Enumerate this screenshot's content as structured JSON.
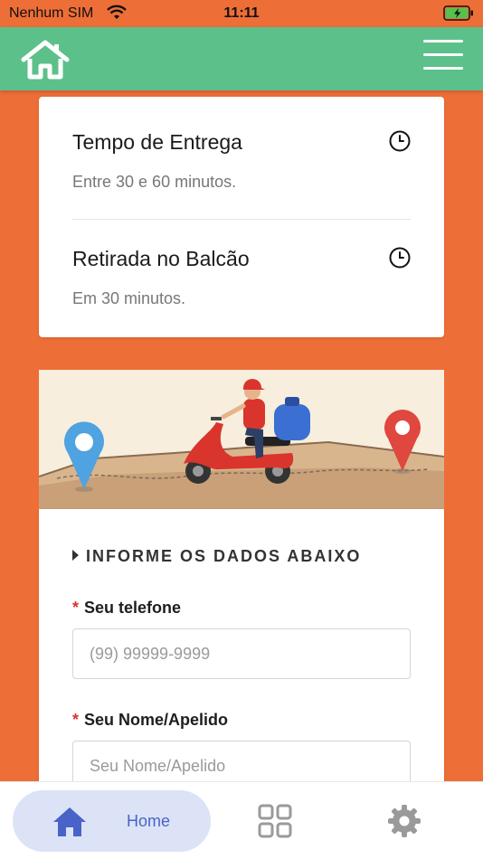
{
  "status_bar": {
    "carrier": "Nenhum SIM",
    "time": "11:11"
  },
  "header": {
    "home_icon": "home-icon",
    "menu_icon": "hamburger-menu-icon",
    "color": "#5CC08A"
  },
  "times_card": {
    "delivery": {
      "title": "Tempo de Entrega",
      "subtitle": "Entre 30 e 60 minutos."
    },
    "pickup": {
      "title": "Retirada no Balcão",
      "subtitle": "Em 30 minutos."
    },
    "icon": "clock-icon"
  },
  "form": {
    "heading": "INFORME OS DADOS ABAIXO",
    "phone": {
      "label": "Seu telefone",
      "placeholder": "(99) 99999-9999",
      "value": ""
    },
    "name": {
      "label": "Seu Nome/Apelido",
      "placeholder": "Seu Nome/Apelido",
      "value": ""
    },
    "required_mark": "*"
  },
  "bottom_nav": {
    "home_label": "Home",
    "active_color": "#4A63C9",
    "active_bg": "#DCE3F7"
  },
  "colors": {
    "background": "#EE6E37",
    "header": "#5CC08A",
    "required": "#D9352D"
  }
}
